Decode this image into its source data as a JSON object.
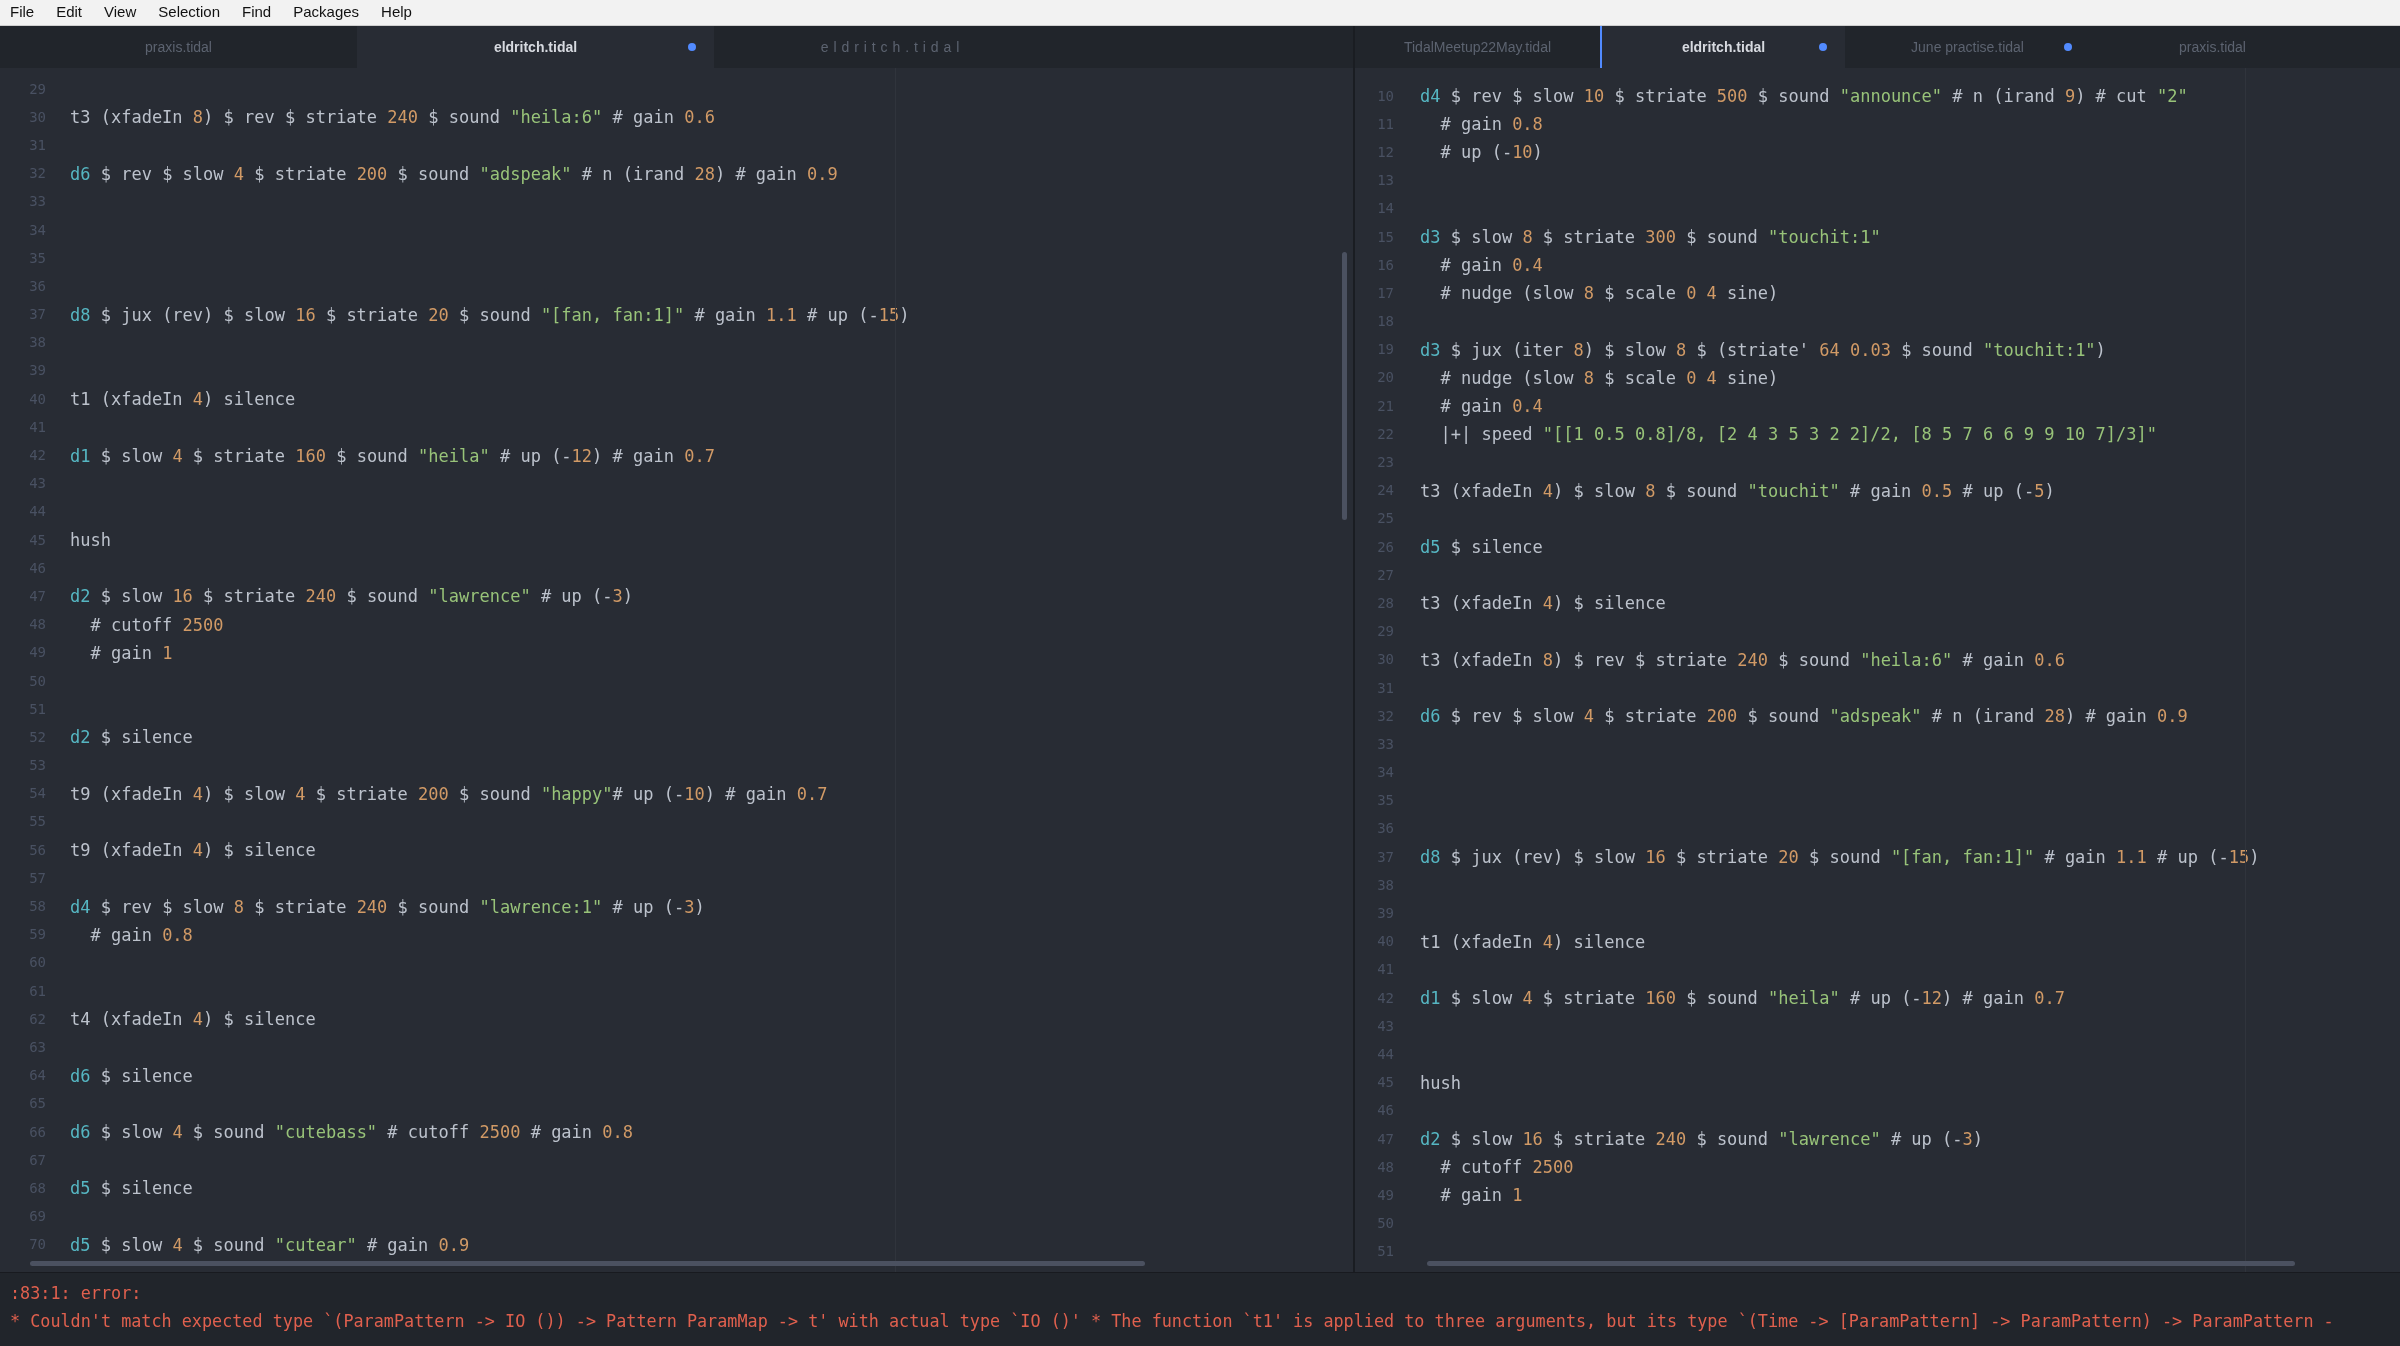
{
  "menu": [
    "File",
    "Edit",
    "View",
    "Selection",
    "Find",
    "Packages",
    "Help"
  ],
  "panes": [
    {
      "tabs": [
        {
          "label": "praxis.tidal",
          "kind": "tab",
          "selected": false,
          "modified": false
        },
        {
          "label": "eldritch.tidal",
          "kind": "tab",
          "selected": true,
          "modified": true
        },
        {
          "label": "eldritch.tidal",
          "kind": "ghost",
          "selected": false,
          "modified": false
        }
      ],
      "lines": [
        {
          "number": "29"
        },
        {
          "number": "30",
          "tokens": [
            {
              "kind": "text",
              "text": "t3 (xfadeIn "
            },
            {
              "kind": "num",
              "text": "8"
            },
            {
              "kind": "text",
              "text": ") $ rev $ striate "
            },
            {
              "kind": "num",
              "text": "240"
            },
            {
              "kind": "text",
              "text": " $ sound "
            },
            {
              "kind": "str",
              "text": "\"heila:6\""
            },
            {
              "kind": "text",
              "text": " # gain "
            },
            {
              "kind": "num",
              "text": "0.6"
            }
          ]
        },
        {
          "number": "31"
        },
        {
          "number": "32",
          "tokens": [
            {
              "kind": "orbit",
              "text": "d6"
            },
            {
              "kind": "text",
              "text": " $ rev $ slow "
            },
            {
              "kind": "num",
              "text": "4"
            },
            {
              "kind": "text",
              "text": " $ striate "
            },
            {
              "kind": "num",
              "text": "200"
            },
            {
              "kind": "text",
              "text": " $ sound "
            },
            {
              "kind": "str",
              "text": "\"adspeak\""
            },
            {
              "kind": "text",
              "text": " # n (irand "
            },
            {
              "kind": "num",
              "text": "28"
            },
            {
              "kind": "text",
              "text": ") # gain "
            },
            {
              "kind": "num",
              "text": "0.9"
            }
          ]
        },
        {
          "number": "33"
        },
        {
          "number": "34"
        },
        {
          "number": "35"
        },
        {
          "number": "36"
        },
        {
          "number": "37",
          "tokens": [
            {
              "kind": "orbit",
              "text": "d8"
            },
            {
              "kind": "text",
              "text": " $ jux (rev) $ slow "
            },
            {
              "kind": "num",
              "text": "16"
            },
            {
              "kind": "text",
              "text": " $ striate "
            },
            {
              "kind": "num",
              "text": "20"
            },
            {
              "kind": "text",
              "text": " $ sound "
            },
            {
              "kind": "str",
              "text": "\"[fan, fan:1]\""
            },
            {
              "kind": "text",
              "text": " # gain "
            },
            {
              "kind": "num",
              "text": "1.1"
            },
            {
              "kind": "text",
              "text": " # up (-"
            },
            {
              "kind": "num",
              "text": "15"
            },
            {
              "kind": "text",
              "text": ")"
            }
          ]
        },
        {
          "number": "38"
        },
        {
          "number": "39"
        },
        {
          "number": "40",
          "tokens": [
            {
              "kind": "text",
              "text": "t1 (xfadeIn "
            },
            {
              "kind": "num",
              "text": "4"
            },
            {
              "kind": "text",
              "text": ") silence"
            }
          ]
        },
        {
          "number": "41"
        },
        {
          "number": "42",
          "tokens": [
            {
              "kind": "orbit",
              "text": "d1"
            },
            {
              "kind": "text",
              "text": " $ slow "
            },
            {
              "kind": "num",
              "text": "4"
            },
            {
              "kind": "text",
              "text": " $ striate "
            },
            {
              "kind": "num",
              "text": "160"
            },
            {
              "kind": "text",
              "text": " $ sound "
            },
            {
              "kind": "str",
              "text": "\"heila\""
            },
            {
              "kind": "text",
              "text": " # up (-"
            },
            {
              "kind": "num",
              "text": "12"
            },
            {
              "kind": "text",
              "text": ") # gain "
            },
            {
              "kind": "num",
              "text": "0.7"
            }
          ]
        },
        {
          "number": "43"
        },
        {
          "number": "44"
        },
        {
          "number": "45",
          "tokens": [
            {
              "kind": "text",
              "text": "hush"
            }
          ]
        },
        {
          "number": "46"
        },
        {
          "number": "47",
          "tokens": [
            {
              "kind": "orbit",
              "text": "d2"
            },
            {
              "kind": "text",
              "text": " $ slow "
            },
            {
              "kind": "num",
              "text": "16"
            },
            {
              "kind": "text",
              "text": " $ striate "
            },
            {
              "kind": "num",
              "text": "240"
            },
            {
              "kind": "text",
              "text": " $ sound "
            },
            {
              "kind": "str",
              "text": "\"lawrence\""
            },
            {
              "kind": "text",
              "text": " # up (-"
            },
            {
              "kind": "num",
              "text": "3"
            },
            {
              "kind": "text",
              "text": ")"
            }
          ]
        },
        {
          "number": "48",
          "tokens": [
            {
              "kind": "text",
              "text": "  # cutoff "
            },
            {
              "kind": "num",
              "text": "2500"
            }
          ]
        },
        {
          "number": "49",
          "tokens": [
            {
              "kind": "text",
              "text": "  # gain "
            },
            {
              "kind": "num",
              "text": "1"
            }
          ]
        },
        {
          "number": "50"
        },
        {
          "number": "51"
        },
        {
          "number": "52",
          "tokens": [
            {
              "kind": "orbit",
              "text": "d2"
            },
            {
              "kind": "text",
              "text": " $ silence"
            }
          ]
        },
        {
          "number": "53"
        },
        {
          "number": "54",
          "tokens": [
            {
              "kind": "text",
              "text": "t9 (xfadeIn "
            },
            {
              "kind": "num",
              "text": "4"
            },
            {
              "kind": "text",
              "text": ") $ slow "
            },
            {
              "kind": "num",
              "text": "4"
            },
            {
              "kind": "text",
              "text": " $ striate "
            },
            {
              "kind": "num",
              "text": "200"
            },
            {
              "kind": "text",
              "text": " $ sound "
            },
            {
              "kind": "str",
              "text": "\"happy\""
            },
            {
              "kind": "text",
              "text": "# up (-"
            },
            {
              "kind": "num",
              "text": "10"
            },
            {
              "kind": "text",
              "text": ") # gain "
            },
            {
              "kind": "num",
              "text": "0.7"
            }
          ]
        },
        {
          "number": "55"
        },
        {
          "number": "56",
          "tokens": [
            {
              "kind": "text",
              "text": "t9 (xfadeIn "
            },
            {
              "kind": "num",
              "text": "4"
            },
            {
              "kind": "text",
              "text": ") $ silence"
            }
          ]
        },
        {
          "number": "57"
        },
        {
          "number": "58",
          "tokens": [
            {
              "kind": "orbit",
              "text": "d4"
            },
            {
              "kind": "text",
              "text": " $ rev $ slow "
            },
            {
              "kind": "num",
              "text": "8"
            },
            {
              "kind": "text",
              "text": " $ striate "
            },
            {
              "kind": "num",
              "text": "240"
            },
            {
              "kind": "text",
              "text": " $ sound "
            },
            {
              "kind": "str",
              "text": "\"lawrence:1\""
            },
            {
              "kind": "text",
              "text": " # up (-"
            },
            {
              "kind": "num",
              "text": "3"
            },
            {
              "kind": "text",
              "text": ")"
            }
          ]
        },
        {
          "number": "59",
          "tokens": [
            {
              "kind": "text",
              "text": "  # gain "
            },
            {
              "kind": "num",
              "text": "0.8"
            }
          ]
        },
        {
          "number": "60"
        },
        {
          "number": "61"
        },
        {
          "number": "62",
          "tokens": [
            {
              "kind": "text",
              "text": "t4 (xfadeIn "
            },
            {
              "kind": "num",
              "text": "4"
            },
            {
              "kind": "text",
              "text": ") $ silence"
            }
          ]
        },
        {
          "number": "63"
        },
        {
          "number": "64",
          "tokens": [
            {
              "kind": "orbit",
              "text": "d6"
            },
            {
              "kind": "text",
              "text": " $ silence"
            }
          ]
        },
        {
          "number": "65"
        },
        {
          "number": "66",
          "tokens": [
            {
              "kind": "orbit",
              "text": "d6"
            },
            {
              "kind": "text",
              "text": " $ slow "
            },
            {
              "kind": "num",
              "text": "4"
            },
            {
              "kind": "text",
              "text": " $ sound "
            },
            {
              "kind": "str",
              "text": "\"cutebass\""
            },
            {
              "kind": "text",
              "text": " # cutoff "
            },
            {
              "kind": "num",
              "text": "2500"
            },
            {
              "kind": "text",
              "text": " # gain "
            },
            {
              "kind": "num",
              "text": "0.8"
            }
          ]
        },
        {
          "number": "67"
        },
        {
          "number": "68",
          "tokens": [
            {
              "kind": "orbit",
              "text": "d5"
            },
            {
              "kind": "text",
              "text": " $ silence"
            }
          ]
        },
        {
          "number": "69"
        },
        {
          "number": "70",
          "tokens": [
            {
              "kind": "orbit",
              "text": "d5"
            },
            {
              "kind": "text",
              "text": " $ slow "
            },
            {
              "kind": "num",
              "text": "4"
            },
            {
              "kind": "text",
              "text": " $ sound "
            },
            {
              "kind": "str",
              "text": "\"cutear\""
            },
            {
              "kind": "text",
              "text": " # gain "
            },
            {
              "kind": "num",
              "text": "0.9"
            }
          ]
        }
      ]
    },
    {
      "tabs": [
        {
          "label": "TidalMeetup22May.tidal",
          "kind": "tab",
          "selected": false,
          "modified": false
        },
        {
          "label": "eldritch.tidal",
          "kind": "tab",
          "selected": true,
          "modified": true
        },
        {
          "label": "June practise.tidal",
          "kind": "tab",
          "selected": false,
          "modified": true
        },
        {
          "label": "praxis.tidal",
          "kind": "tab",
          "selected": false,
          "modified": false
        }
      ],
      "lines": [
        {
          "number": "10",
          "tokens": [
            {
              "kind": "orbit",
              "text": "d4"
            },
            {
              "kind": "text",
              "text": " $ rev $ slow "
            },
            {
              "kind": "num",
              "text": "10"
            },
            {
              "kind": "text",
              "text": " $ striate "
            },
            {
              "kind": "num",
              "text": "500"
            },
            {
              "kind": "text",
              "text": " $ sound "
            },
            {
              "kind": "str",
              "text": "\"announce\""
            },
            {
              "kind": "text",
              "text": " # n (irand "
            },
            {
              "kind": "num",
              "text": "9"
            },
            {
              "kind": "text",
              "text": ") # cut "
            },
            {
              "kind": "str",
              "text": "\"2\""
            }
          ]
        },
        {
          "number": "11",
          "tokens": [
            {
              "kind": "text",
              "text": "  # gain "
            },
            {
              "kind": "num",
              "text": "0.8"
            }
          ]
        },
        {
          "number": "12",
          "tokens": [
            {
              "kind": "text",
              "text": "  # up (-"
            },
            {
              "kind": "num",
              "text": "10"
            },
            {
              "kind": "text",
              "text": ")"
            }
          ]
        },
        {
          "number": "13"
        },
        {
          "number": "14"
        },
        {
          "number": "15",
          "tokens": [
            {
              "kind": "orbit",
              "text": "d3"
            },
            {
              "kind": "text",
              "text": " $ slow "
            },
            {
              "kind": "num",
              "text": "8"
            },
            {
              "kind": "text",
              "text": " $ striate "
            },
            {
              "kind": "num",
              "text": "300"
            },
            {
              "kind": "text",
              "text": " $ sound "
            },
            {
              "kind": "str",
              "text": "\"touchit:1\""
            }
          ]
        },
        {
          "number": "16",
          "tokens": [
            {
              "kind": "text",
              "text": "  # gain "
            },
            {
              "kind": "num",
              "text": "0.4"
            }
          ]
        },
        {
          "number": "17",
          "tokens": [
            {
              "kind": "text",
              "text": "  # nudge (slow "
            },
            {
              "kind": "num",
              "text": "8"
            },
            {
              "kind": "text",
              "text": " $ scale "
            },
            {
              "kind": "num",
              "text": "0 4"
            },
            {
              "kind": "text",
              "text": " sine)"
            }
          ]
        },
        {
          "number": "18"
        },
        {
          "number": "19",
          "tokens": [
            {
              "kind": "orbit",
              "text": "d3"
            },
            {
              "kind": "text",
              "text": " $ jux (iter "
            },
            {
              "kind": "num",
              "text": "8"
            },
            {
              "kind": "text",
              "text": ") $ slow "
            },
            {
              "kind": "num",
              "text": "8"
            },
            {
              "kind": "text",
              "text": " $ (striate' "
            },
            {
              "kind": "num",
              "text": "64 0.03"
            },
            {
              "kind": "text",
              "text": " $ sound "
            },
            {
              "kind": "str",
              "text": "\"touchit:1\""
            },
            {
              "kind": "text",
              "text": ")"
            }
          ]
        },
        {
          "number": "20",
          "tokens": [
            {
              "kind": "text",
              "text": "  # nudge (slow "
            },
            {
              "kind": "num",
              "text": "8"
            },
            {
              "kind": "text",
              "text": " $ scale "
            },
            {
              "kind": "num",
              "text": "0 4"
            },
            {
              "kind": "text",
              "text": " sine)"
            }
          ]
        },
        {
          "number": "21",
          "tokens": [
            {
              "kind": "text",
              "text": "  # gain "
            },
            {
              "kind": "num",
              "text": "0.4"
            }
          ]
        },
        {
          "number": "22",
          "tokens": [
            {
              "kind": "text",
              "text": "  |+| speed "
            },
            {
              "kind": "str",
              "text": "\"[[1 0.5 0.8]/8, [2 4 3 5 3 2 2]/2, [8 5 7 6 6 9 9 10 7]/3]\""
            }
          ]
        },
        {
          "number": "23"
        },
        {
          "number": "24",
          "tokens": [
            {
              "kind": "text",
              "text": "t3 (xfadeIn "
            },
            {
              "kind": "num",
              "text": "4"
            },
            {
              "kind": "text",
              "text": ") $ slow "
            },
            {
              "kind": "num",
              "text": "8"
            },
            {
              "kind": "text",
              "text": " $ sound "
            },
            {
              "kind": "str",
              "text": "\"touchit\""
            },
            {
              "kind": "text",
              "text": " # gain "
            },
            {
              "kind": "num",
              "text": "0.5"
            },
            {
              "kind": "text",
              "text": " # up (-"
            },
            {
              "kind": "num",
              "text": "5"
            },
            {
              "kind": "text",
              "text": ")"
            }
          ]
        },
        {
          "number": "25"
        },
        {
          "number": "26",
          "tokens": [
            {
              "kind": "orbit",
              "text": "d5"
            },
            {
              "kind": "text",
              "text": " $ silence"
            }
          ]
        },
        {
          "number": "27"
        },
        {
          "number": "28",
          "tokens": [
            {
              "kind": "text",
              "text": "t3 (xfadeIn "
            },
            {
              "kind": "num",
              "text": "4"
            },
            {
              "kind": "text",
              "text": ") $ silence"
            }
          ]
        },
        {
          "number": "29"
        },
        {
          "number": "30",
          "tokens": [
            {
              "kind": "text",
              "text": "t3 (xfadeIn "
            },
            {
              "kind": "num",
              "text": "8"
            },
            {
              "kind": "text",
              "text": ") $ rev $ striate "
            },
            {
              "kind": "num",
              "text": "240"
            },
            {
              "kind": "text",
              "text": " $ sound "
            },
            {
              "kind": "str",
              "text": "\"heila:6\""
            },
            {
              "kind": "text",
              "text": " # gain "
            },
            {
              "kind": "num",
              "text": "0.6"
            }
          ]
        },
        {
          "number": "31"
        },
        {
          "number": "32",
          "tokens": [
            {
              "kind": "orbit",
              "text": "d6"
            },
            {
              "kind": "text",
              "text": " $ rev $ slow "
            },
            {
              "kind": "num",
              "text": "4"
            },
            {
              "kind": "text",
              "text": " $ striate "
            },
            {
              "kind": "num",
              "text": "200"
            },
            {
              "kind": "text",
              "text": " $ sound "
            },
            {
              "kind": "str",
              "text": "\"adspeak\""
            },
            {
              "kind": "text",
              "text": " # n (irand "
            },
            {
              "kind": "num",
              "text": "28"
            },
            {
              "kind": "text",
              "text": ") # gain "
            },
            {
              "kind": "num",
              "text": "0.9"
            }
          ]
        },
        {
          "number": "33"
        },
        {
          "number": "34"
        },
        {
          "number": "35"
        },
        {
          "number": "36"
        },
        {
          "number": "37",
          "tokens": [
            {
              "kind": "orbit",
              "text": "d8"
            },
            {
              "kind": "text",
              "text": " $ jux (rev) $ slow "
            },
            {
              "kind": "num",
              "text": "16"
            },
            {
              "kind": "text",
              "text": " $ striate "
            },
            {
              "kind": "num",
              "text": "20"
            },
            {
              "kind": "text",
              "text": " $ sound "
            },
            {
              "kind": "str",
              "text": "\"[fan, fan:1]\""
            },
            {
              "kind": "text",
              "text": " # gain "
            },
            {
              "kind": "num",
              "text": "1.1"
            },
            {
              "kind": "text",
              "text": " # up (-"
            },
            {
              "kind": "num",
              "text": "15"
            },
            {
              "kind": "text",
              "text": ")"
            }
          ]
        },
        {
          "number": "38"
        },
        {
          "number": "39"
        },
        {
          "number": "40",
          "tokens": [
            {
              "kind": "text",
              "text": "t1 (xfadeIn "
            },
            {
              "kind": "num",
              "text": "4"
            },
            {
              "kind": "text",
              "text": ") silence"
            }
          ]
        },
        {
          "number": "41"
        },
        {
          "number": "42",
          "tokens": [
            {
              "kind": "orbit",
              "text": "d1"
            },
            {
              "kind": "text",
              "text": " $ slow "
            },
            {
              "kind": "num",
              "text": "4"
            },
            {
              "kind": "text",
              "text": " $ striate "
            },
            {
              "kind": "num",
              "text": "160"
            },
            {
              "kind": "text",
              "text": " $ sound "
            },
            {
              "kind": "str",
              "text": "\"heila\""
            },
            {
              "kind": "text",
              "text": " # up (-"
            },
            {
              "kind": "num",
              "text": "12"
            },
            {
              "kind": "text",
              "text": ") # gain "
            },
            {
              "kind": "num",
              "text": "0.7"
            }
          ]
        },
        {
          "number": "43"
        },
        {
          "number": "44"
        },
        {
          "number": "45",
          "tokens": [
            {
              "kind": "text",
              "text": "hush"
            }
          ]
        },
        {
          "number": "46"
        },
        {
          "number": "47",
          "tokens": [
            {
              "kind": "orbit",
              "text": "d2"
            },
            {
              "kind": "text",
              "text": " $ slow "
            },
            {
              "kind": "num",
              "text": "16"
            },
            {
              "kind": "text",
              "text": " $ striate "
            },
            {
              "kind": "num",
              "text": "240"
            },
            {
              "kind": "text",
              "text": " $ sound "
            },
            {
              "kind": "str",
              "text": "\"lawrence\""
            },
            {
              "kind": "text",
              "text": " # up (-"
            },
            {
              "kind": "num",
              "text": "3"
            },
            {
              "kind": "text",
              "text": ")"
            }
          ]
        },
        {
          "number": "48",
          "tokens": [
            {
              "kind": "text",
              "text": "  # cutoff "
            },
            {
              "kind": "num",
              "text": "2500"
            }
          ]
        },
        {
          "number": "49",
          "tokens": [
            {
              "kind": "text",
              "text": "  # gain "
            },
            {
              "kind": "num",
              "text": "1"
            }
          ]
        },
        {
          "number": "50"
        },
        {
          "number": "51"
        }
      ]
    }
  ],
  "console": {
    "lines": [
      ":83:1: error:",
      "* Couldn't match expected type `(ParamPattern -> IO ()) -> Pattern ParamMap -> t' with actual type `IO ()' * The function `t1' is applied to three arguments, but its type `(Time -> [ParamPattern] -> ParamPattern) -> ParamPattern -"
    ]
  }
}
